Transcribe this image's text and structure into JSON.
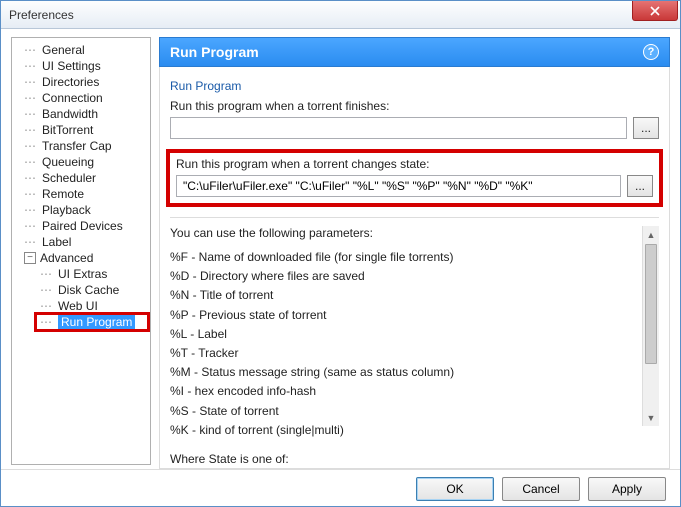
{
  "window": {
    "title": "Preferences"
  },
  "tree": {
    "items": [
      {
        "label": "General",
        "level": 0,
        "type": "dash"
      },
      {
        "label": "UI Settings",
        "level": 0,
        "type": "dash"
      },
      {
        "label": "Directories",
        "level": 0,
        "type": "dash"
      },
      {
        "label": "Connection",
        "level": 0,
        "type": "dash"
      },
      {
        "label": "Bandwidth",
        "level": 0,
        "type": "dash"
      },
      {
        "label": "BitTorrent",
        "level": 0,
        "type": "dash"
      },
      {
        "label": "Transfer Cap",
        "level": 0,
        "type": "dash"
      },
      {
        "label": "Queueing",
        "level": 0,
        "type": "dash"
      },
      {
        "label": "Scheduler",
        "level": 0,
        "type": "dash"
      },
      {
        "label": "Remote",
        "level": 0,
        "type": "dash"
      },
      {
        "label": "Playback",
        "level": 0,
        "type": "dash"
      },
      {
        "label": "Paired Devices",
        "level": 0,
        "type": "dash"
      },
      {
        "label": "Label",
        "level": 0,
        "type": "dash"
      },
      {
        "label": "Advanced",
        "level": 0,
        "type": "expander"
      },
      {
        "label": "UI Extras",
        "level": 1,
        "type": "dash"
      },
      {
        "label": "Disk Cache",
        "level": 1,
        "type": "dash"
      },
      {
        "label": "Web UI",
        "level": 1,
        "type": "dash"
      },
      {
        "label": "Run Program",
        "level": 1,
        "type": "dash",
        "selected": true,
        "highlighted": true
      }
    ]
  },
  "header": {
    "title": "Run Program"
  },
  "section": {
    "group_title": "Run Program",
    "finish_label": "Run this program when a torrent finishes:",
    "finish_value": "",
    "state_label": "Run this program when a torrent changes state:",
    "state_value": "\"C:\\uFiler\\uFiler.exe\" \"C:\\uFiler\" \"%L\" \"%S\" \"%P\" \"%N\" \"%D\" \"%K\"",
    "browse": "..."
  },
  "params": {
    "intro": "You can use the following parameters:",
    "lines": [
      "%F - Name of downloaded file (for single file torrents)",
      "%D - Directory where files are saved",
      "%N - Title of torrent",
      "%P - Previous state of torrent",
      "%L - Label",
      "%T - Tracker",
      "%M - Status message string (same as status column)",
      "%I - hex encoded info-hash",
      "%S - State of torrent",
      "%K - kind of torrent (single|multi)"
    ],
    "where": "Where State is one of:"
  },
  "buttons": {
    "ok": "OK",
    "cancel": "Cancel",
    "apply": "Apply"
  }
}
